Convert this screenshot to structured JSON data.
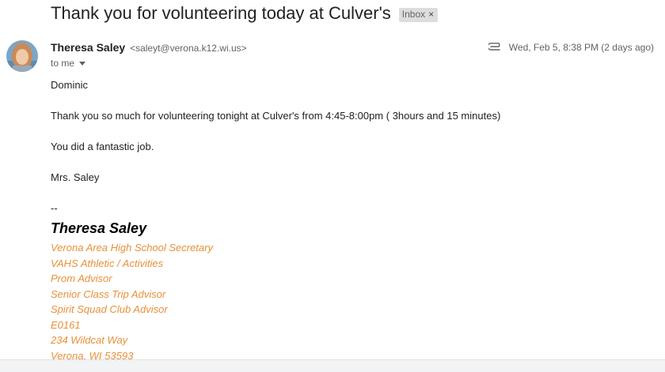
{
  "email": {
    "subject": "Thank you for volunteering today at Culver's",
    "label": "Inbox",
    "label_remove": "×",
    "sender_name": "Theresa Saley",
    "sender_email": "<saleyt@verona.k12.wi.us>",
    "to": "to me",
    "date": "Wed, Feb 5, 8:38 PM (2 days ago)",
    "body": {
      "greeting": "Dominic",
      "line1": "Thank you so much for volunteering tonight at Culver's from 4:45-8:00pm ( 3hours and 15 minutes)",
      "line2": "You did a fantastic job.",
      "closing": "Mrs. Saley",
      "separator": "--"
    },
    "signature": {
      "name": "Theresa Saley",
      "lines": [
        "Verona Area High School Secretary",
        "VAHS Athletic / Activities",
        "Prom Advisor",
        "Senior Class Trip Advisor",
        "Spirit Squad Club Advisor",
        "E0161",
        "234 Wildcat Way",
        "Verona, WI 53593"
      ]
    }
  },
  "icons": {
    "attachment": "paperclip-icon",
    "caret": "chevron-down-icon",
    "avatar": "avatar"
  },
  "colors": {
    "signature_accent": "#e69138",
    "label_bg": "#dddddd"
  }
}
